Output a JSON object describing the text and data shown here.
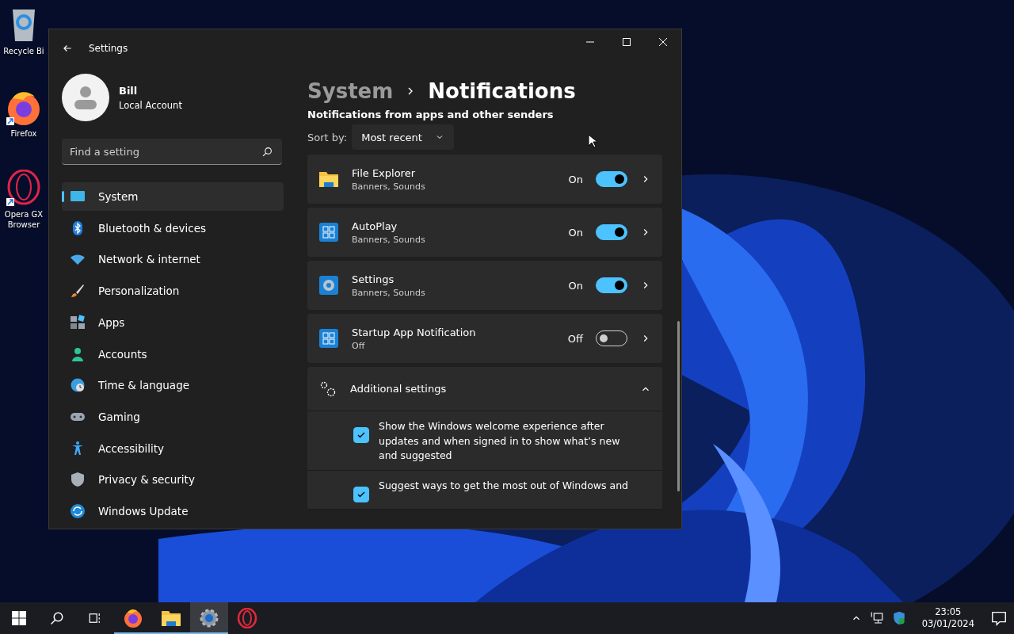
{
  "desktop_icons": [
    {
      "label": "Recycle Bi",
      "kind": "recycle"
    },
    {
      "label": "Firefox",
      "kind": "firefox"
    },
    {
      "label": "Opera GX Browser",
      "kind": "opera"
    }
  ],
  "window": {
    "title": "Settings"
  },
  "user": {
    "name": "Bill",
    "account": "Local Account"
  },
  "search": {
    "placeholder": "Find a setting"
  },
  "nav": [
    {
      "label": "System",
      "kind": "system",
      "selected": true
    },
    {
      "label": "Bluetooth & devices",
      "kind": "bluetooth",
      "selected": false
    },
    {
      "label": "Network & internet",
      "kind": "network",
      "selected": false
    },
    {
      "label": "Personalization",
      "kind": "brush",
      "selected": false
    },
    {
      "label": "Apps",
      "kind": "apps",
      "selected": false
    },
    {
      "label": "Accounts",
      "kind": "person",
      "selected": false
    },
    {
      "label": "Time & language",
      "kind": "globe",
      "selected": false
    },
    {
      "label": "Gaming",
      "kind": "gamepad",
      "selected": false
    },
    {
      "label": "Accessibility",
      "kind": "accessibility",
      "selected": false
    },
    {
      "label": "Privacy & security",
      "kind": "shield",
      "selected": false
    },
    {
      "label": "Windows Update",
      "kind": "update",
      "selected": false
    }
  ],
  "breadcrumb": {
    "parent": "System",
    "current": "Notifications"
  },
  "section_heading": "Notifications from apps and other senders",
  "sort": {
    "label": "Sort by:",
    "value": "Most recent"
  },
  "apps": [
    {
      "name": "File Explorer",
      "detail": "Banners, Sounds",
      "state": "On",
      "on": true,
      "kind": "folder"
    },
    {
      "name": "AutoPlay",
      "detail": "Banners, Sounds",
      "state": "On",
      "on": true,
      "kind": "tile"
    },
    {
      "name": "Settings",
      "detail": "Banners, Sounds",
      "state": "On",
      "on": true,
      "kind": "gear"
    },
    {
      "name": "Startup App Notification",
      "detail": "Off",
      "state": "Off",
      "on": false,
      "kind": "tile"
    }
  ],
  "additional": {
    "label": "Additional settings",
    "expanded": true,
    "options": [
      {
        "text": "Show the Windows welcome experience after updates and when signed in to show what’s new and suggested",
        "checked": true
      },
      {
        "text": "Suggest ways to get the most out of Windows and",
        "checked": true
      }
    ]
  },
  "taskbar": {
    "apps": [
      {
        "kind": "firefox",
        "selected": false
      },
      {
        "kind": "folder",
        "selected": false
      },
      {
        "kind": "gear",
        "selected": true
      },
      {
        "kind": "opera",
        "selected": false
      }
    ],
    "clock": {
      "time": "23:05",
      "date": "03/01/2024"
    }
  }
}
